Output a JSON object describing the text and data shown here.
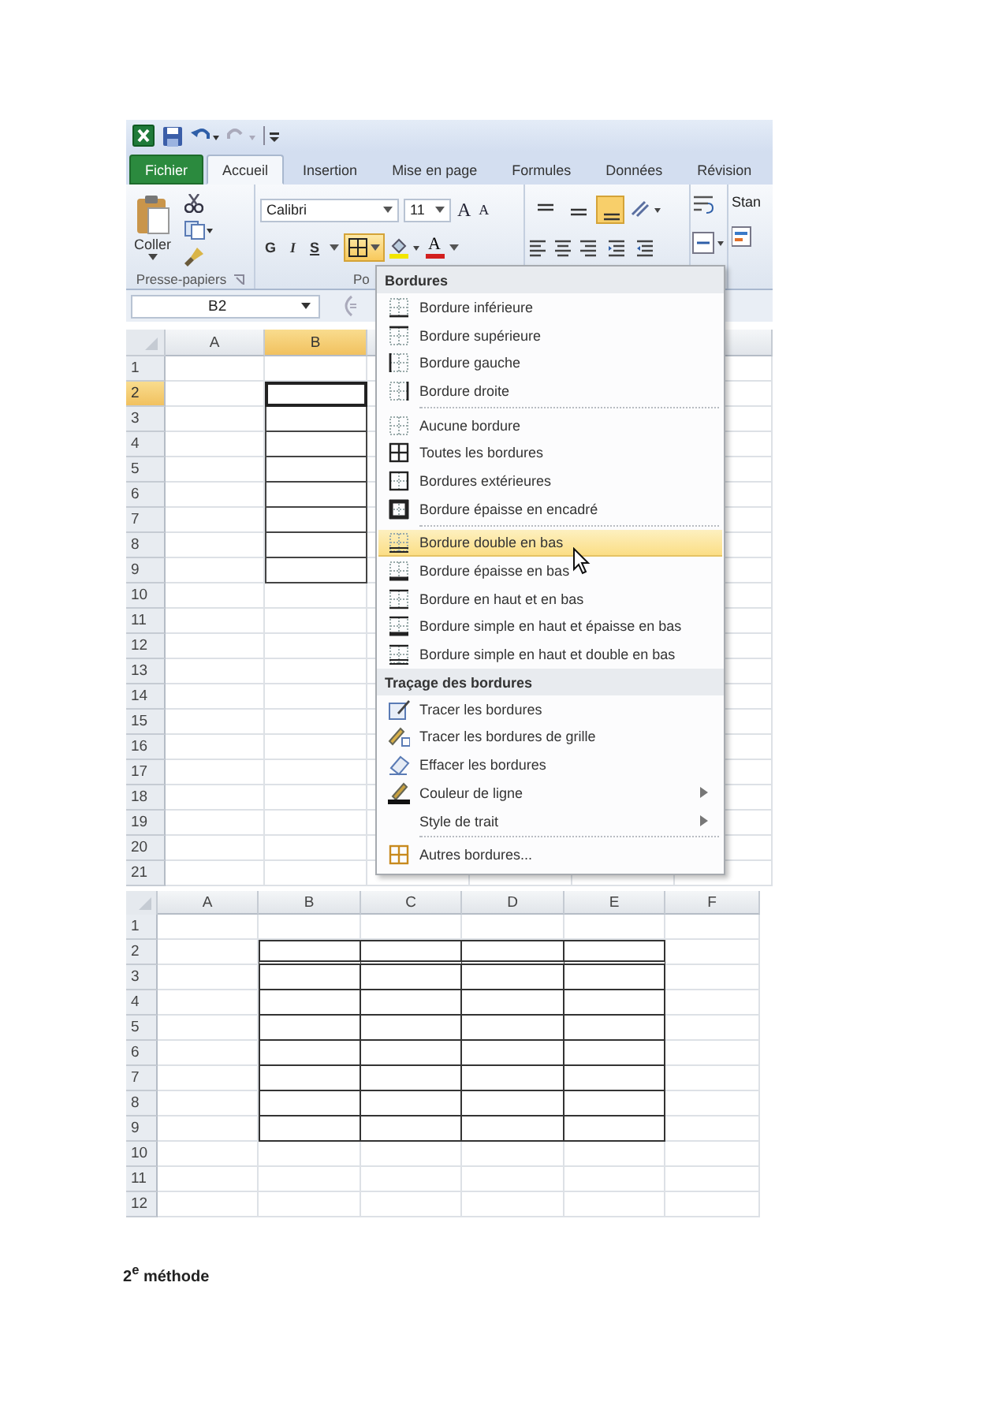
{
  "excel_window": {
    "tabs": [
      {
        "label": "Fichier",
        "kind": "file",
        "selected": false
      },
      {
        "label": "Accueil",
        "kind": "tab",
        "selected": true
      },
      {
        "label": "Insertion",
        "kind": "tab",
        "selected": false
      },
      {
        "label": "Mise en page",
        "kind": "tab",
        "selected": false
      },
      {
        "label": "Formules",
        "kind": "tab",
        "selected": false
      },
      {
        "label": "Données",
        "kind": "tab",
        "selected": false
      },
      {
        "label": "Révision",
        "kind": "tab",
        "selected": false
      }
    ],
    "ribbon": {
      "paste_label": "Coller",
      "clipboard_group": "Presse-papiers",
      "font_name": "Calibri",
      "font_size": "11",
      "font_size_buttons": [
        {
          "label": "A",
          "kind": "grow"
        },
        {
          "label": "A",
          "kind": "shrink"
        }
      ],
      "style_buttons": [
        {
          "label": "G",
          "kind": "bold"
        },
        {
          "label": "I",
          "kind": "italic"
        },
        {
          "label": "S",
          "kind": "underline"
        }
      ],
      "borders_button": {
        "open": true
      },
      "font_color_label": "A",
      "font_group": "Po",
      "vertical_align": [
        {
          "kind": "top",
          "selected": false
        },
        {
          "kind": "middle",
          "selected": false
        },
        {
          "kind": "bottom",
          "selected": true
        }
      ],
      "styles_cut": "Stan"
    },
    "name_box": "B2",
    "columns": [
      {
        "label": "A",
        "selected": false
      },
      {
        "label": "B",
        "selected": true
      }
    ],
    "rows": [
      {
        "label": "1",
        "selected": false,
        "cells": [
          {
            "bordered": false
          },
          {
            "bordered": false
          }
        ]
      },
      {
        "label": "2",
        "selected": true,
        "cells": [
          {
            "bordered": false
          },
          {
            "bordered": true
          }
        ]
      },
      {
        "label": "3",
        "selected": false,
        "cells": [
          {
            "bordered": false
          },
          {
            "bordered": true
          }
        ]
      },
      {
        "label": "4",
        "selected": false,
        "cells": [
          {
            "bordered": false
          },
          {
            "bordered": true
          }
        ]
      },
      {
        "label": "5",
        "selected": false,
        "cells": [
          {
            "bordered": false
          },
          {
            "bordered": true
          }
        ]
      },
      {
        "label": "6",
        "selected": false,
        "cells": [
          {
            "bordered": false
          },
          {
            "bordered": true
          }
        ]
      },
      {
        "label": "7",
        "selected": false,
        "cells": [
          {
            "bordered": false
          },
          {
            "bordered": true
          }
        ]
      },
      {
        "label": "8",
        "selected": false,
        "cells": [
          {
            "bordered": false
          },
          {
            "bordered": true
          }
        ]
      },
      {
        "label": "9",
        "selected": false,
        "cells": [
          {
            "bordered": false
          },
          {
            "bordered": true
          }
        ]
      },
      {
        "label": "10",
        "selected": false,
        "cells": [
          {
            "bordered": false
          },
          {
            "bordered": false
          }
        ]
      },
      {
        "label": "11",
        "selected": false,
        "cells": [
          {
            "bordered": false
          },
          {
            "bordered": false
          }
        ]
      },
      {
        "label": "12",
        "selected": false,
        "cells": [
          {
            "bordered": false
          },
          {
            "bordered": false
          }
        ]
      },
      {
        "label": "13",
        "selected": false,
        "cells": [
          {
            "bordered": false
          },
          {
            "bordered": false
          }
        ]
      },
      {
        "label": "14",
        "selected": false,
        "cells": [
          {
            "bordered": false
          },
          {
            "bordered": false
          }
        ]
      },
      {
        "label": "15",
        "selected": false,
        "cells": [
          {
            "bordered": false
          },
          {
            "bordered": false
          }
        ]
      },
      {
        "label": "16",
        "selected": false,
        "cells": [
          {
            "bordered": false
          },
          {
            "bordered": false
          }
        ]
      },
      {
        "label": "17",
        "selected": false,
        "cells": [
          {
            "bordered": false
          },
          {
            "bordered": false
          }
        ]
      },
      {
        "label": "18",
        "selected": false,
        "cells": [
          {
            "bordered": false
          },
          {
            "bordered": false
          }
        ]
      },
      {
        "label": "19",
        "selected": false,
        "cells": [
          {
            "bordered": false
          },
          {
            "bordered": false
          }
        ]
      },
      {
        "label": "20",
        "selected": false,
        "cells": [
          {
            "bordered": false
          },
          {
            "bordered": false
          }
        ]
      },
      {
        "label": "21",
        "selected": false,
        "cells": [
          {
            "bordered": false
          },
          {
            "bordered": false
          }
        ]
      }
    ],
    "borders_menu": [
      {
        "heading": "Bordures",
        "items": [
          {
            "label": "Bordure inférieure",
            "kind": "bottom",
            "separator_before": false,
            "submenu": false,
            "selected": false
          },
          {
            "label": "Bordure supérieure",
            "kind": "top",
            "separator_before": false,
            "submenu": false,
            "selected": false
          },
          {
            "label": "Bordure gauche",
            "kind": "left",
            "separator_before": false,
            "submenu": false,
            "selected": false
          },
          {
            "label": "Bordure droite",
            "kind": "right",
            "separator_before": false,
            "submenu": false,
            "selected": false
          },
          {
            "label": "Aucune bordure",
            "kind": "no-border",
            "separator_before": true,
            "submenu": false,
            "selected": false
          },
          {
            "label": "Toutes les bordures",
            "kind": "all",
            "separator_before": false,
            "submenu": false,
            "selected": false
          },
          {
            "label": "Bordures extérieures",
            "kind": "outside",
            "separator_before": false,
            "submenu": false,
            "selected": false
          },
          {
            "label": "Bordure épaisse en encadré",
            "kind": "thick-box",
            "separator_before": false,
            "submenu": false,
            "selected": false
          },
          {
            "label": "Bordure double en bas",
            "kind": "double-bottom",
            "separator_before": true,
            "submenu": false,
            "selected": true
          },
          {
            "label": "Bordure épaisse en bas",
            "kind": "thick-bottom",
            "separator_before": false,
            "submenu": false,
            "selected": false
          },
          {
            "label": "Bordure en haut et en bas",
            "kind": "top-bottom",
            "separator_before": false,
            "submenu": false,
            "selected": false
          },
          {
            "label": "Bordure simple en haut et épaisse en bas",
            "kind": "top-thick-bottom",
            "separator_before": false,
            "submenu": false,
            "selected": false
          },
          {
            "label": "Bordure simple en haut et double en bas",
            "kind": "top-double-bottom",
            "separator_before": false,
            "submenu": false,
            "selected": false
          }
        ]
      },
      {
        "heading": "Traçage des bordures",
        "items": [
          {
            "label": "Tracer les bordures",
            "kind": "draw",
            "separator_before": false,
            "submenu": false,
            "selected": false
          },
          {
            "label": "Tracer les bordures de grille",
            "kind": "draw-grid",
            "separator_before": false,
            "submenu": false,
            "selected": false
          },
          {
            "label": "Effacer les bordures",
            "kind": "erase",
            "separator_before": false,
            "submenu": false,
            "selected": false
          },
          {
            "label": "Couleur de ligne",
            "kind": "line-color",
            "separator_before": false,
            "submenu": true,
            "selected": false
          },
          {
            "label": "Style de trait",
            "kind": "none",
            "separator_before": false,
            "submenu": true,
            "selected": false
          },
          {
            "label": "Autres bordures...",
            "kind": "more",
            "separator_before": true,
            "submenu": false,
            "selected": false
          }
        ]
      }
    ]
  },
  "result_sheet": {
    "columns": [
      "A",
      "B",
      "C",
      "D",
      "E",
      "F"
    ],
    "rows": [
      {
        "label": "1",
        "cells": [
          {
            "bordered": false,
            "double_bottom": false
          },
          {
            "bordered": false,
            "double_bottom": false
          },
          {
            "bordered": false,
            "double_bottom": false
          },
          {
            "bordered": false,
            "double_bottom": false
          },
          {
            "bordered": false,
            "double_bottom": false
          },
          {
            "bordered": false,
            "double_bottom": false
          }
        ]
      },
      {
        "label": "2",
        "cells": [
          {
            "bordered": false,
            "double_bottom": false
          },
          {
            "bordered": true,
            "double_bottom": true
          },
          {
            "bordered": true,
            "double_bottom": true
          },
          {
            "bordered": true,
            "double_bottom": true
          },
          {
            "bordered": true,
            "double_bottom": true
          },
          {
            "bordered": false,
            "double_bottom": false
          }
        ]
      },
      {
        "label": "3",
        "cells": [
          {
            "bordered": false,
            "double_bottom": false
          },
          {
            "bordered": true,
            "double_bottom": false
          },
          {
            "bordered": true,
            "double_bottom": false
          },
          {
            "bordered": true,
            "double_bottom": false
          },
          {
            "bordered": true,
            "double_bottom": false
          },
          {
            "bordered": false,
            "double_bottom": false
          }
        ]
      },
      {
        "label": "4",
        "cells": [
          {
            "bordered": false,
            "double_bottom": false
          },
          {
            "bordered": true,
            "double_bottom": false
          },
          {
            "bordered": true,
            "double_bottom": false
          },
          {
            "bordered": true,
            "double_bottom": false
          },
          {
            "bordered": true,
            "double_bottom": false
          },
          {
            "bordered": false,
            "double_bottom": false
          }
        ]
      },
      {
        "label": "5",
        "cells": [
          {
            "bordered": false,
            "double_bottom": false
          },
          {
            "bordered": true,
            "double_bottom": false
          },
          {
            "bordered": true,
            "double_bottom": false
          },
          {
            "bordered": true,
            "double_bottom": false
          },
          {
            "bordered": true,
            "double_bottom": false
          },
          {
            "bordered": false,
            "double_bottom": false
          }
        ]
      },
      {
        "label": "6",
        "cells": [
          {
            "bordered": false,
            "double_bottom": false
          },
          {
            "bordered": true,
            "double_bottom": false
          },
          {
            "bordered": true,
            "double_bottom": false
          },
          {
            "bordered": true,
            "double_bottom": false
          },
          {
            "bordered": true,
            "double_bottom": false
          },
          {
            "bordered": false,
            "double_bottom": false
          }
        ]
      },
      {
        "label": "7",
        "cells": [
          {
            "bordered": false,
            "double_bottom": false
          },
          {
            "bordered": true,
            "double_bottom": false
          },
          {
            "bordered": true,
            "double_bottom": false
          },
          {
            "bordered": true,
            "double_bottom": false
          },
          {
            "bordered": true,
            "double_bottom": false
          },
          {
            "bordered": false,
            "double_bottom": false
          }
        ]
      },
      {
        "label": "8",
        "cells": [
          {
            "bordered": false,
            "double_bottom": false
          },
          {
            "bordered": true,
            "double_bottom": false
          },
          {
            "bordered": true,
            "double_bottom": false
          },
          {
            "bordered": true,
            "double_bottom": false
          },
          {
            "bordered": true,
            "double_bottom": false
          },
          {
            "bordered": false,
            "double_bottom": false
          }
        ]
      },
      {
        "label": "9",
        "cells": [
          {
            "bordered": false,
            "double_bottom": false
          },
          {
            "bordered": true,
            "double_bottom": false
          },
          {
            "bordered": true,
            "double_bottom": false
          },
          {
            "bordered": true,
            "double_bottom": false
          },
          {
            "bordered": true,
            "double_bottom": false
          },
          {
            "bordered": false,
            "double_bottom": false
          }
        ]
      },
      {
        "label": "10",
        "cells": [
          {
            "bordered": false,
            "double_bottom": false
          },
          {
            "bordered": false,
            "double_bottom": false
          },
          {
            "bordered": false,
            "double_bottom": false
          },
          {
            "bordered": false,
            "double_bottom": false
          },
          {
            "bordered": false,
            "double_bottom": false
          },
          {
            "bordered": false,
            "double_bottom": false
          }
        ]
      },
      {
        "label": "11",
        "cells": [
          {
            "bordered": false,
            "double_bottom": false
          },
          {
            "bordered": false,
            "double_bottom": false
          },
          {
            "bordered": false,
            "double_bottom": false
          },
          {
            "bordered": false,
            "double_bottom": false
          },
          {
            "bordered": false,
            "double_bottom": false
          },
          {
            "bordered": false,
            "double_bottom": false
          }
        ]
      },
      {
        "label": "12",
        "cells": [
          {
            "bordered": false,
            "double_bottom": false
          },
          {
            "bordered": false,
            "double_bottom": false
          },
          {
            "bordered": false,
            "double_bottom": false
          },
          {
            "bordered": false,
            "double_bottom": false
          },
          {
            "bordered": false,
            "double_bottom": false
          },
          {
            "bordered": false,
            "double_bottom": false
          }
        ]
      }
    ]
  },
  "caption": "2$^{e}$ méthode"
}
